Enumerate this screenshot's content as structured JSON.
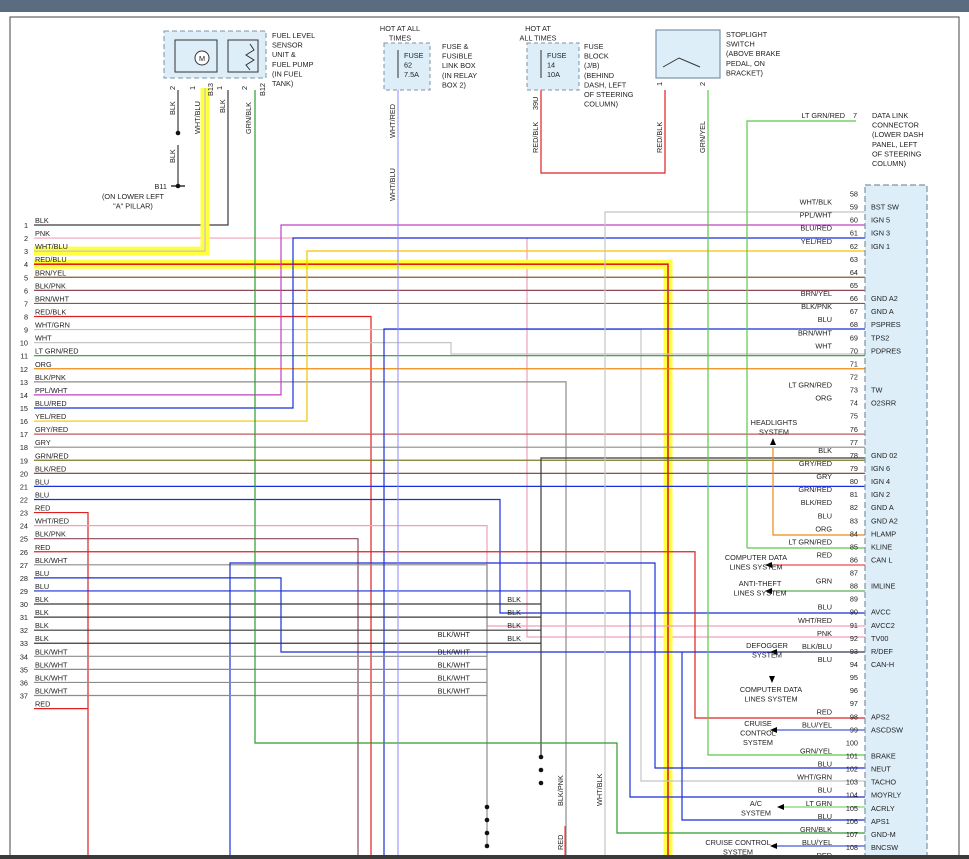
{
  "components": {
    "fuel_sensor": {
      "label": [
        "FUEL LEVEL",
        "SENSOR",
        "UNIT &",
        "FUEL PUMP",
        "(IN FUEL",
        "TANK)"
      ],
      "motor_symbol": "M",
      "pins": [
        "2",
        "1",
        "1",
        "2"
      ],
      "connectors": [
        "B13",
        "B12"
      ],
      "wire_labels": [
        "BLK",
        "WHT/BLU",
        "BLK",
        "GRN/BLK"
      ]
    },
    "fuse62": {
      "hot_label": [
        "HOT AT ALL",
        "TIMES"
      ],
      "label": [
        "FUSE &",
        "FUSIBLE",
        "LINK BOX",
        "(IN RELAY",
        "BOX 2)"
      ],
      "fuse_text": [
        "FUSE",
        "62",
        "7.5A"
      ],
      "wire_labels": [
        "WHT/RED",
        "WHT/BLU"
      ]
    },
    "fuse14": {
      "hot_label": [
        "HOT AT",
        "ALL TIMES"
      ],
      "label": [
        "FUSE",
        "BLOCK",
        "(J/B)",
        "(BEHIND",
        "DASH, LEFT",
        "OF STEERING",
        "COLUMN)"
      ],
      "fuse_text": [
        "FUSE",
        "14",
        "10A"
      ],
      "pin": "39U",
      "wire_labels": [
        "RED/BLK",
        "RED/BLK"
      ]
    },
    "stoplight": {
      "label": [
        "STOPLIGHT",
        "SWITCH",
        "(ABOVE BRAKE",
        "PEDAL, ON",
        "BRACKET)"
      ],
      "pins": [
        "1",
        "2"
      ],
      "wire_labels": [
        "GRN/YEL"
      ]
    },
    "ground_b11": {
      "id": "B11",
      "label": [
        "(ON LOWER LEFT",
        "\"A\" PILLAR)"
      ],
      "wire_label": "BLK"
    },
    "data_link": {
      "wire": "LT GRN/RED",
      "pin": "7",
      "label": [
        "DATA LINK",
        "CONNECTOR",
        "(LOWER DASH",
        "PANEL, LEFT",
        "OF STEERING",
        "COLUMN)"
      ]
    }
  },
  "left_pins": [
    {
      "n": "1",
      "label": "BLK"
    },
    {
      "n": "2",
      "label": "PNK"
    },
    {
      "n": "3",
      "label": "WHT/BLU"
    },
    {
      "n": "4",
      "label": "RED/BLU"
    },
    {
      "n": "5",
      "label": "BRN/YEL"
    },
    {
      "n": "6",
      "label": "BLK/PNK"
    },
    {
      "n": "7",
      "label": "BRN/WHT"
    },
    {
      "n": "8",
      "label": "RED/BLK"
    },
    {
      "n": "9",
      "label": "WHT/GRN"
    },
    {
      "n": "10",
      "label": "WHT"
    },
    {
      "n": "11",
      "label": "LT GRN/RED"
    },
    {
      "n": "12",
      "label": "ORG"
    },
    {
      "n": "13",
      "label": "BLK/PNK"
    },
    {
      "n": "14",
      "label": "PPL/WHT"
    },
    {
      "n": "15",
      "label": "BLU/RED"
    },
    {
      "n": "16",
      "label": "YEL/RED"
    },
    {
      "n": "17",
      "label": "GRY/RED"
    },
    {
      "n": "18",
      "label": "GRY"
    },
    {
      "n": "19",
      "label": "GRN/RED"
    },
    {
      "n": "20",
      "label": "BLK/RED"
    },
    {
      "n": "21",
      "label": "BLU"
    },
    {
      "n": "22",
      "label": "BLU"
    },
    {
      "n": "23",
      "label": "RED"
    },
    {
      "n": "24",
      "label": "WHT/RED"
    },
    {
      "n": "25",
      "label": "BLK/PNK"
    },
    {
      "n": "26",
      "label": "RED"
    },
    {
      "n": "27",
      "label": "BLK/WHT"
    },
    {
      "n": "28",
      "label": "BLU"
    },
    {
      "n": "29",
      "label": "BLU"
    },
    {
      "n": "30",
      "label": "BLK"
    },
    {
      "n": "31",
      "label": "BLK"
    },
    {
      "n": "32",
      "label": "BLK"
    },
    {
      "n": "33",
      "label": "BLK"
    },
    {
      "n": "34",
      "label": "BLK/WHT"
    },
    {
      "n": "35",
      "label": "BLK/WHT"
    },
    {
      "n": "36",
      "label": "BLK/WHT"
    },
    {
      "n": "37",
      "label": "BLK/WHT"
    },
    {
      "n": "",
      "label": "RED"
    }
  ],
  "right_pins": [
    {
      "n": "58",
      "wire": "",
      "func": ""
    },
    {
      "n": "59",
      "wire": "WHT/BLK",
      "func": "BST SW"
    },
    {
      "n": "60",
      "wire": "PPL/WHT",
      "func": "IGN 5"
    },
    {
      "n": "61",
      "wire": "BLU/RED",
      "func": "IGN 3"
    },
    {
      "n": "62",
      "wire": "YEL/RED",
      "func": "IGN 1"
    },
    {
      "n": "63",
      "wire": "",
      "func": ""
    },
    {
      "n": "64",
      "wire": "",
      "func": ""
    },
    {
      "n": "65",
      "wire": "",
      "func": ""
    },
    {
      "n": "66",
      "wire": "BRN/YEL",
      "func": "GND A2"
    },
    {
      "n": "67",
      "wire": "BLK/PNK",
      "func": "GND A"
    },
    {
      "n": "68",
      "wire": "BLU",
      "func": "PSPRES"
    },
    {
      "n": "69",
      "wire": "BRN/WHT",
      "func": "TPS2"
    },
    {
      "n": "70",
      "wire": "WHT",
      "func": "PDPRES"
    },
    {
      "n": "71",
      "wire": "",
      "func": ""
    },
    {
      "n": "72",
      "wire": "",
      "func": ""
    },
    {
      "n": "73",
      "wire": "LT GRN/RED",
      "func": "TW"
    },
    {
      "n": "74",
      "wire": "ORG",
      "func": "O2SRR"
    },
    {
      "n": "75",
      "wire": "",
      "func": ""
    },
    {
      "n": "76",
      "wire": "",
      "func": ""
    },
    {
      "n": "77",
      "wire": "",
      "func": ""
    },
    {
      "n": "78",
      "wire": "BLK",
      "func": "GND 02"
    },
    {
      "n": "79",
      "wire": "GRY/RED",
      "func": "IGN 6"
    },
    {
      "n": "80",
      "wire": "GRY",
      "func": "IGN 4"
    },
    {
      "n": "81",
      "wire": "GRN/RED",
      "func": "IGN 2"
    },
    {
      "n": "82",
      "wire": "BLK/RED",
      "func": "GND A"
    },
    {
      "n": "83",
      "wire": "BLU",
      "func": "GND A2"
    },
    {
      "n": "84",
      "wire": "ORG",
      "func": "HLAMP"
    },
    {
      "n": "85",
      "wire": "LT GRN/RED",
      "func": "KLINE"
    },
    {
      "n": "86",
      "wire": "RED",
      "func": "CAN L"
    },
    {
      "n": "87",
      "wire": "",
      "func": ""
    },
    {
      "n": "88",
      "wire": "GRN",
      "func": "IMLINE"
    },
    {
      "n": "89",
      "wire": "",
      "func": ""
    },
    {
      "n": "90",
      "wire": "BLU",
      "func": "AVCC"
    },
    {
      "n": "91",
      "wire": "WHT/RED",
      "func": "AVCC2"
    },
    {
      "n": "92",
      "wire": "PNK",
      "func": "TV00"
    },
    {
      "n": "93",
      "wire": "BLK/BLU",
      "func": "R/DEF"
    },
    {
      "n": "94",
      "wire": "BLU",
      "func": "CAN-H"
    },
    {
      "n": "95",
      "wire": "",
      "func": ""
    },
    {
      "n": "96",
      "wire": "",
      "func": ""
    },
    {
      "n": "97",
      "wire": "",
      "func": ""
    },
    {
      "n": "98",
      "wire": "RED",
      "func": "APS2"
    },
    {
      "n": "99",
      "wire": "BLU/YEL",
      "func": "ASCDSW"
    },
    {
      "n": "100",
      "wire": "",
      "func": ""
    },
    {
      "n": "101",
      "wire": "GRN/YEL",
      "func": "BRAKE"
    },
    {
      "n": "102",
      "wire": "BLU",
      "func": "NEUT"
    },
    {
      "n": "103",
      "wire": "WHT/GRN",
      "func": "TACHO"
    },
    {
      "n": "104",
      "wire": "BLU",
      "func": "MOYRLY"
    },
    {
      "n": "105",
      "wire": "LT GRN",
      "func": "ACRLY"
    },
    {
      "n": "106",
      "wire": "BLU",
      "func": "APS1"
    },
    {
      "n": "107",
      "wire": "GRN/BLK",
      "func": "GND-M"
    },
    {
      "n": "108",
      "wire": "BLU/YEL",
      "func": "BNCSW"
    },
    {
      "n": "109",
      "wire": "RED",
      "func": ""
    }
  ],
  "systems": {
    "headlights": [
      "HEADLIGHTS",
      "SYSTEM"
    ],
    "computer_data_1": [
      "COMPUTER DATA",
      "LINES SYSTEM"
    ],
    "anti_theft": [
      "ANTI-THEFT",
      "LINES SYSTEM"
    ],
    "defogger": [
      "DEFOGGER",
      "SYSTEM"
    ],
    "computer_data_2": [
      "COMPUTER DATA",
      "LINES SYSTEM"
    ],
    "cruise_1": [
      "CRUISE",
      "CONTROL",
      "SYSTEM"
    ],
    "ac": [
      "A/C",
      "SYSTEM"
    ],
    "cruise_2": [
      "CRUISE CONTROL",
      "SYSTEM"
    ]
  },
  "splice_labels": {
    "blk_wht_27": "BLK/WHT",
    "blk": [
      "BLK",
      "BLK",
      "BLK",
      "BLK"
    ],
    "blk_wht": [
      "BLK/WHT",
      "BLK/WHT",
      "BLK/WHT",
      "BLK/WHT"
    ],
    "vertical": [
      "BLK/PNK",
      "RED",
      "WHT/BLK"
    ]
  },
  "colors": {
    "BLK": "#3a3a3a",
    "WHT": "#c4c4c4",
    "RED": "#e02020",
    "BLU": "#1a2fd8",
    "GRN": "#2f9a2f",
    "LTGRN": "#5cc84a",
    "ORG": "#f08a10",
    "YEL": "#f5c400",
    "PNK": "#f0a0b8",
    "PPL": "#c040c0",
    "BRN": "#8a5a2a",
    "GRY": "#8c8c8c",
    "highlight": "#ffff40",
    "module_fill": "#ddeef9",
    "module_border": "#7c93a6"
  }
}
